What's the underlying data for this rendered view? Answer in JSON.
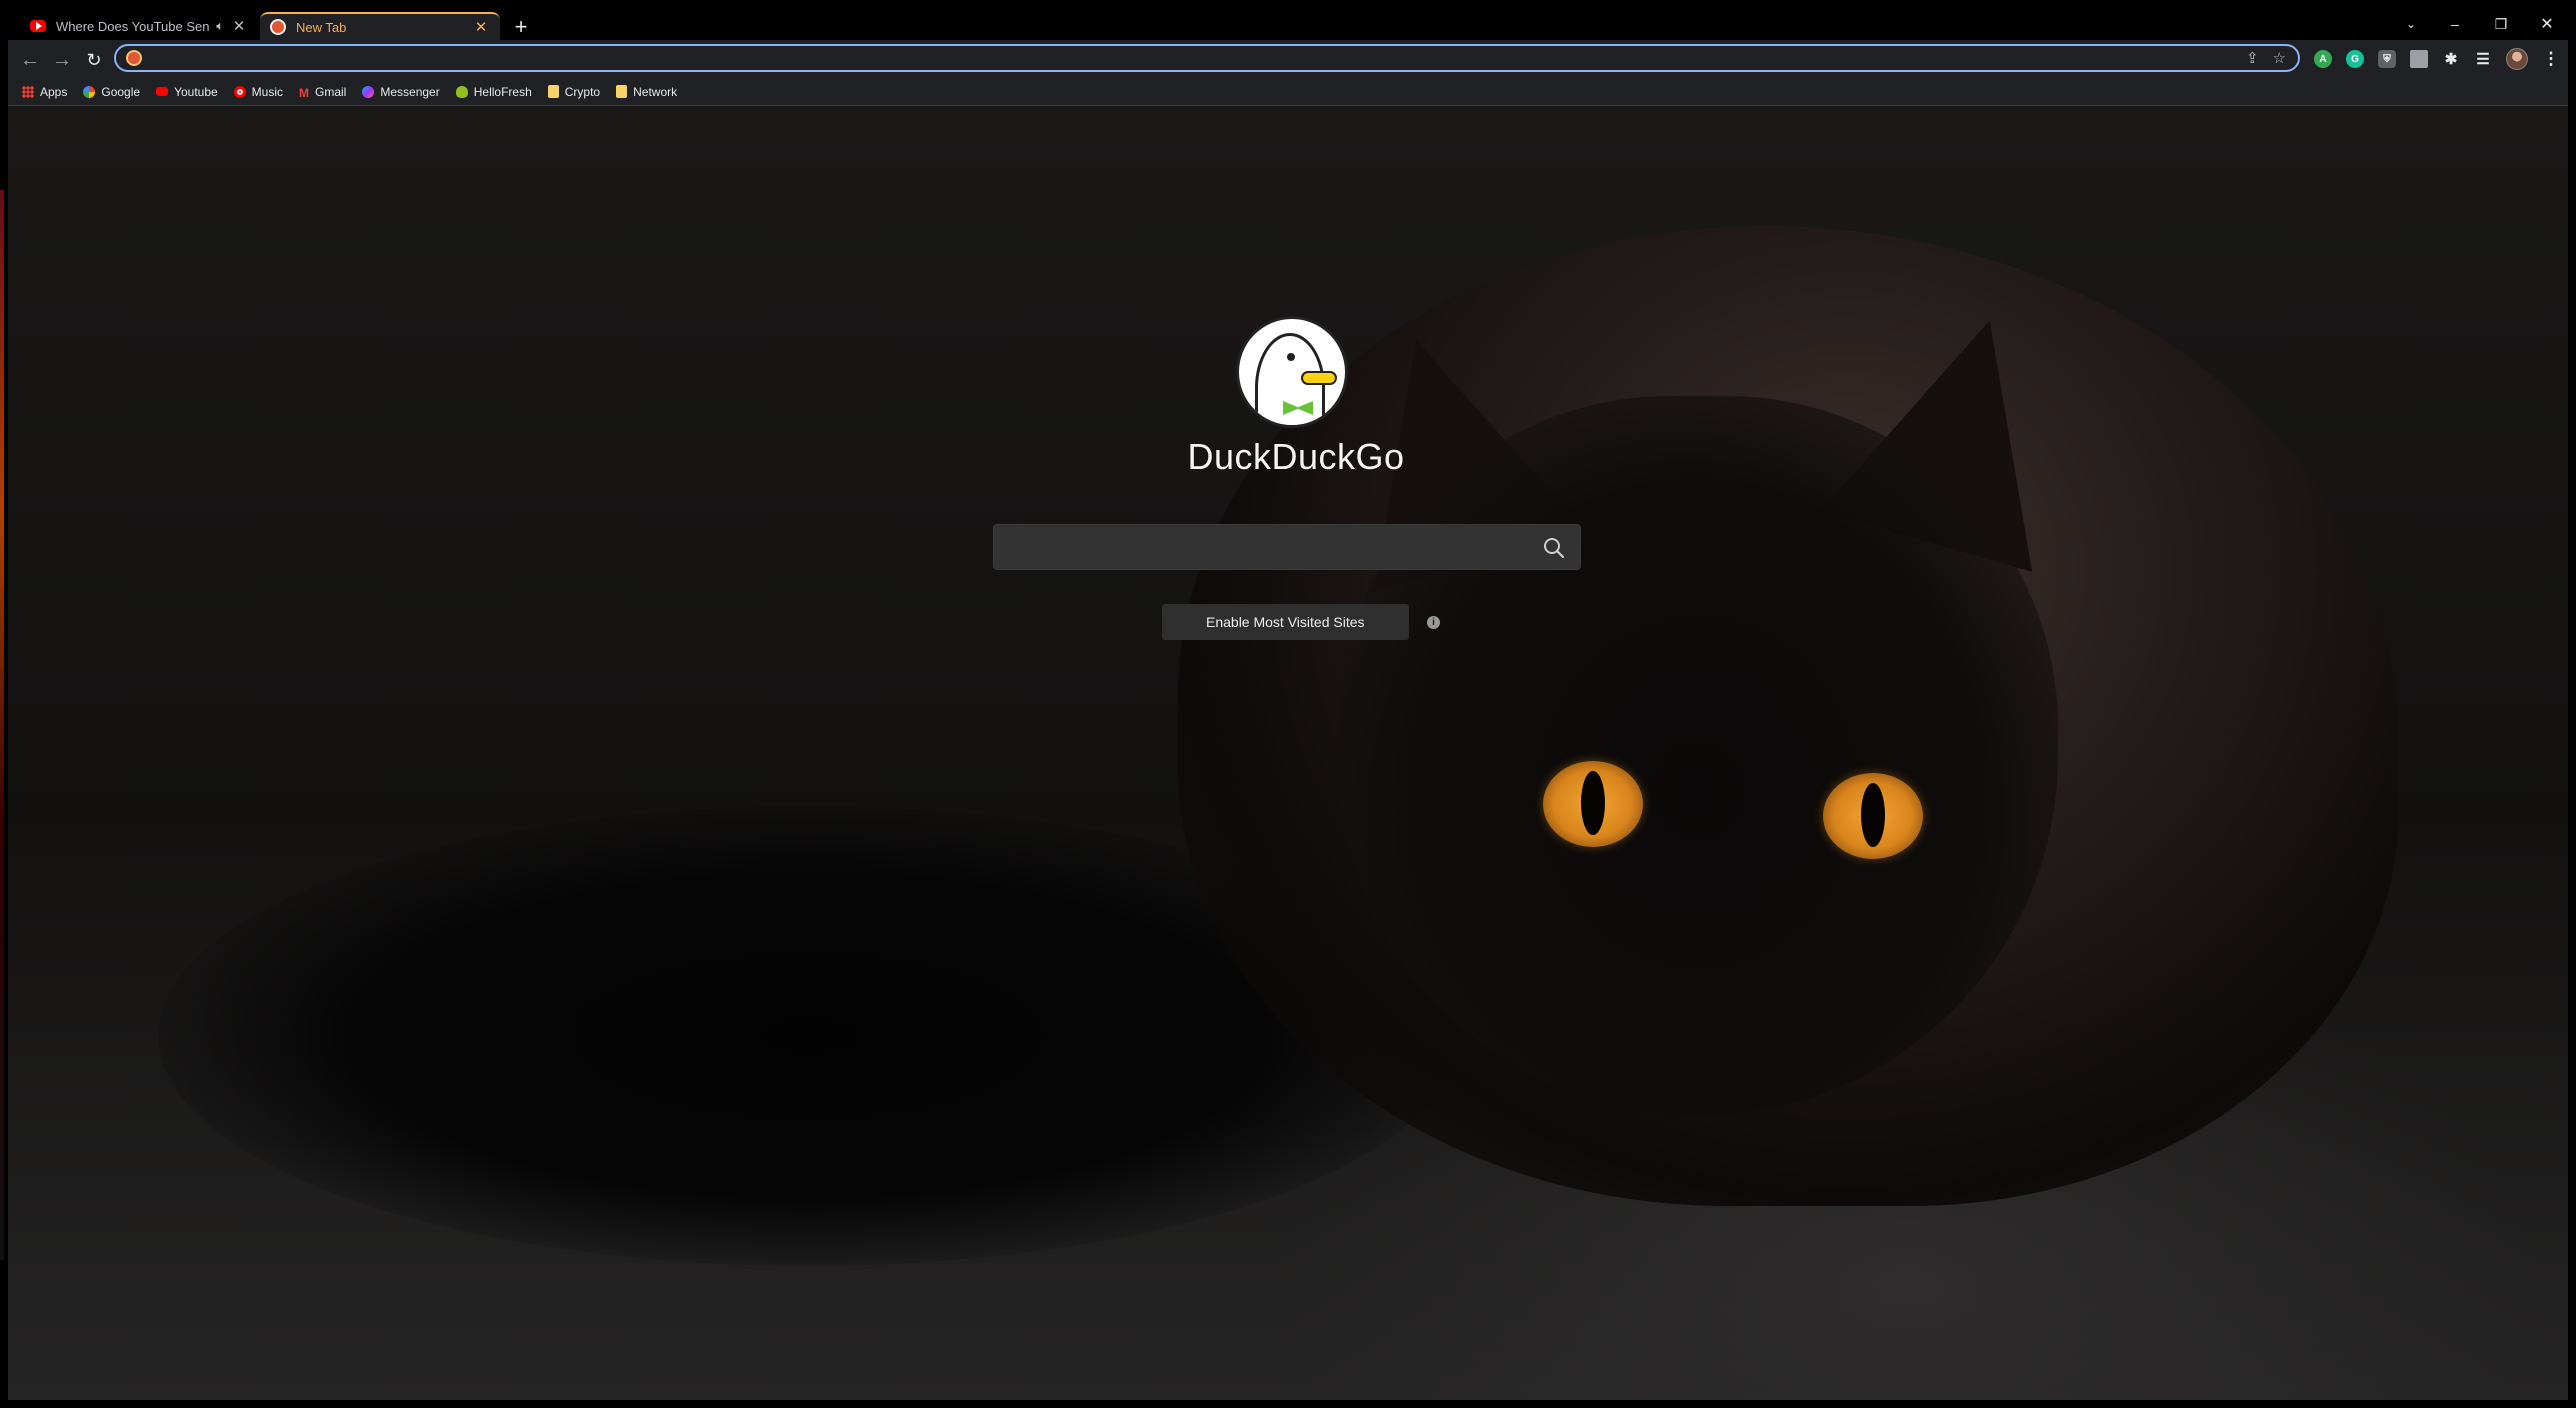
{
  "browser": {
    "tabs": [
      {
        "title": "Where Does YouTube Send I",
        "favicon": "youtube-icon",
        "audio": "speaker-muted-icon",
        "active": false
      },
      {
        "title": "New Tab",
        "favicon": "duckduckgo-icon",
        "active": true
      }
    ],
    "new_tab_symbol": "+",
    "window_controls": {
      "tab_search": "⌄",
      "minimize": "–",
      "restore": "❐",
      "close": "✕"
    }
  },
  "toolbar": {
    "back": "←",
    "forward": "→",
    "reload": "↻",
    "address_value": "",
    "omnibox_icons": [
      "share-icon",
      "star-icon"
    ],
    "extensions": [
      "A",
      "G",
      "",
      ""
    ],
    "menu": "⋮"
  },
  "bookmarks": [
    {
      "label": "Apps",
      "icon": "apps-grid-icon"
    },
    {
      "label": "Google",
      "icon": "google-icon"
    },
    {
      "label": "Youtube",
      "icon": "youtube-icon"
    },
    {
      "label": "Music",
      "icon": "youtube-music-icon"
    },
    {
      "label": "Gmail",
      "icon": "gmail-icon"
    },
    {
      "label": "Messenger",
      "icon": "messenger-icon"
    },
    {
      "label": "HelloFresh",
      "icon": "hellofresh-icon"
    },
    {
      "label": "Crypto",
      "icon": "folder-icon"
    },
    {
      "label": "Network",
      "icon": "folder-icon"
    }
  ],
  "page": {
    "brand": "DuckDuckGo",
    "search_value": "",
    "enable_button": "Enable Most Visited Sites",
    "info_symbol": "i"
  },
  "colors": {
    "active_tab_accent": "#f6ad55",
    "omnibox_focus": "#8ab4f8",
    "ddg_orange": "#de5833",
    "cat_eye": "#f2a531"
  }
}
